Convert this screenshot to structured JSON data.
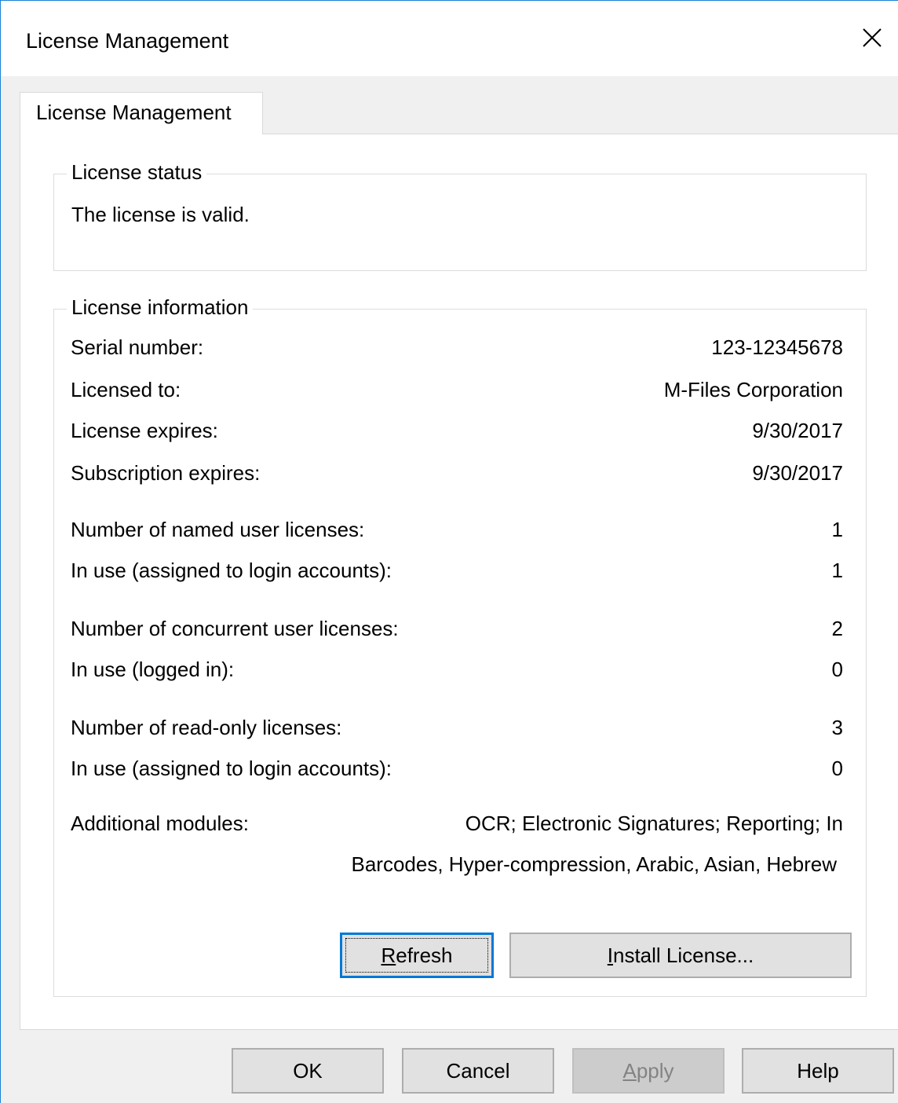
{
  "window": {
    "title": "License Management"
  },
  "tabs": [
    {
      "label": "License Management"
    }
  ],
  "status_group": {
    "legend": "License status",
    "text": "The license is valid."
  },
  "info_group": {
    "legend": "License information",
    "rows": [
      {
        "label": "Serial number:",
        "value": "123-12345678"
      },
      {
        "label": "Licensed to:",
        "value": "M-Files Corporation"
      },
      {
        "label": "License expires:",
        "value": "9/30/2017"
      },
      {
        "label": "Subscription expires:",
        "value": "9/30/2017"
      },
      {
        "label": "Number of named user licenses:",
        "value": "1"
      },
      {
        "label": "In use (assigned to login accounts):",
        "value": "1"
      },
      {
        "label": "Number of concurrent user licenses:",
        "value": "2"
      },
      {
        "label": "In use (logged in):",
        "value": "0"
      },
      {
        "label": "Number of read-only licenses:",
        "value": "3"
      },
      {
        "label": "In use (assigned to login accounts):",
        "value": "0"
      }
    ],
    "modules_label": "Additional modules:",
    "modules_line1": "OCR; Electronic Signatures; Reporting; In",
    "modules_line2": "Barcodes, Hyper-compression, Arabic, Asian, Hebrew",
    "refresh_mnemonic": "R",
    "refresh_rest": "efresh",
    "install_mnemonic": "I",
    "install_rest": "nstall License..."
  },
  "footer": {
    "ok_label": "OK",
    "cancel_label": "Cancel",
    "apply_mnemonic": "A",
    "apply_rest": "pply",
    "help_label": "Help"
  }
}
